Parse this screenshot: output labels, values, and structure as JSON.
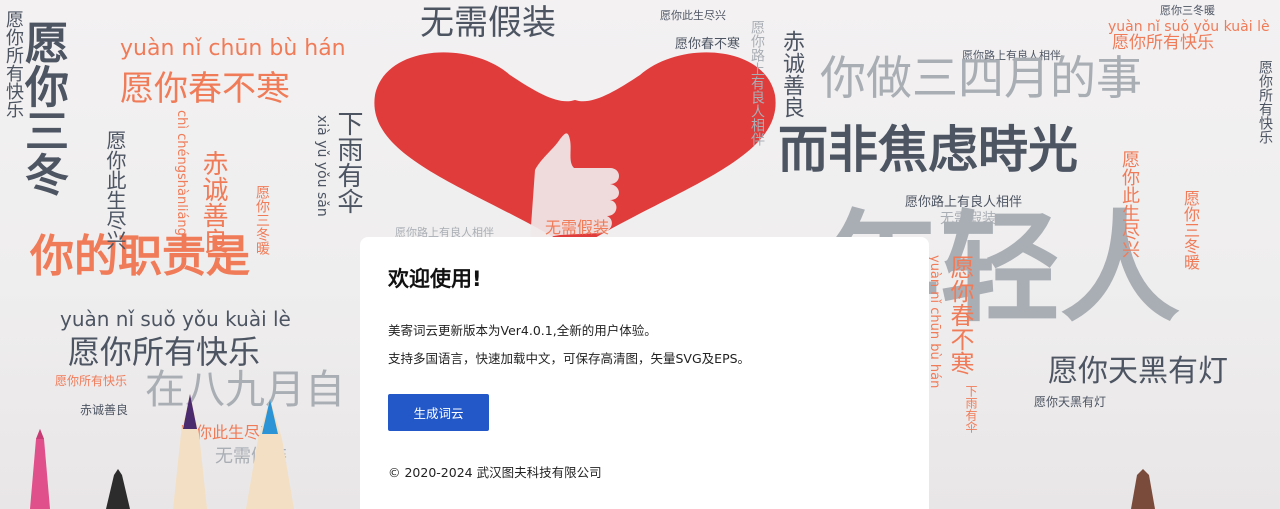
{
  "background": {
    "words": [
      "无需假装",
      "愿你春不寒",
      "yuàn nǐ chūn bù hán",
      "愿你所有快乐",
      "yuàn nǐ suǒ yǒu kuài lè",
      "你做三四月的事",
      "而非焦虑時光",
      "年轻人",
      "愿你天黑有灯",
      "下雨有伞",
      "xià yǔ yǒu sǎn",
      "赤诚善良",
      "chì chéngshànliáng",
      "愿你此生尽兴",
      "你的职责是",
      "愿你三冬暖",
      "愿你路上有良人相伴",
      "在八九月自",
      "愿你春不寒",
      "愿你所有快乐"
    ]
  },
  "colors": {
    "heart": "#e03c3c",
    "button": "#2358c9",
    "word_dark": "#4d5563",
    "word_gray": "#a9aeb5",
    "word_orange": "#f07b58"
  },
  "card": {
    "title": "欢迎使用!",
    "line1": "美寄词云更新版本为Ver4.0.1,全新的用户体验。",
    "line2": "支持多国语言，快速加载中文，可保存高清图，矢量SVG及EPS。",
    "button_label": "生成词云",
    "copyright": "© 2020-2024 武汉图夫科技有限公司"
  }
}
